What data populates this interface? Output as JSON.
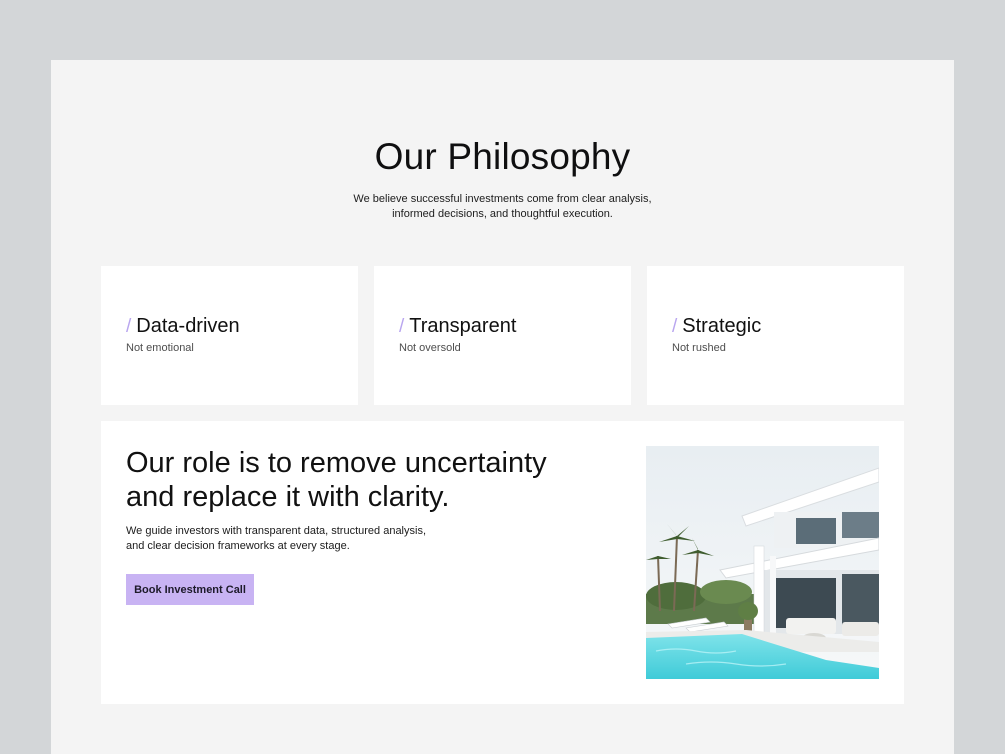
{
  "section": {
    "title": "Our Philosophy",
    "subtitle_lines": [
      "We believe successful investments come from clear analysis,",
      "informed decisions, and thoughtful execution."
    ]
  },
  "cards": [
    {
      "slash": "/",
      "title": "Data-driven",
      "subtitle": "Not emotional"
    },
    {
      "slash": "/",
      "title": "Transparent",
      "subtitle": "Not oversold"
    },
    {
      "slash": "/",
      "title": "Strategic",
      "subtitle": "Not rushed"
    }
  ],
  "feature": {
    "headline_lines": [
      "Our role is to remove uncertainty",
      "and replace it with clarity."
    ],
    "body_lines": [
      "We guide investors with transparent data, structured analysis,",
      "and clear decision frameworks at every stage."
    ],
    "cta_label": "Book Investment Call",
    "image_subject": "modern-villa-with-pool-photo"
  },
  "colors": {
    "backdrop": "#d3d6d8",
    "page": "#f4f4f4",
    "card": "#ffffff",
    "accent": "#c8b3f3",
    "slash": "#b9a6ef"
  }
}
